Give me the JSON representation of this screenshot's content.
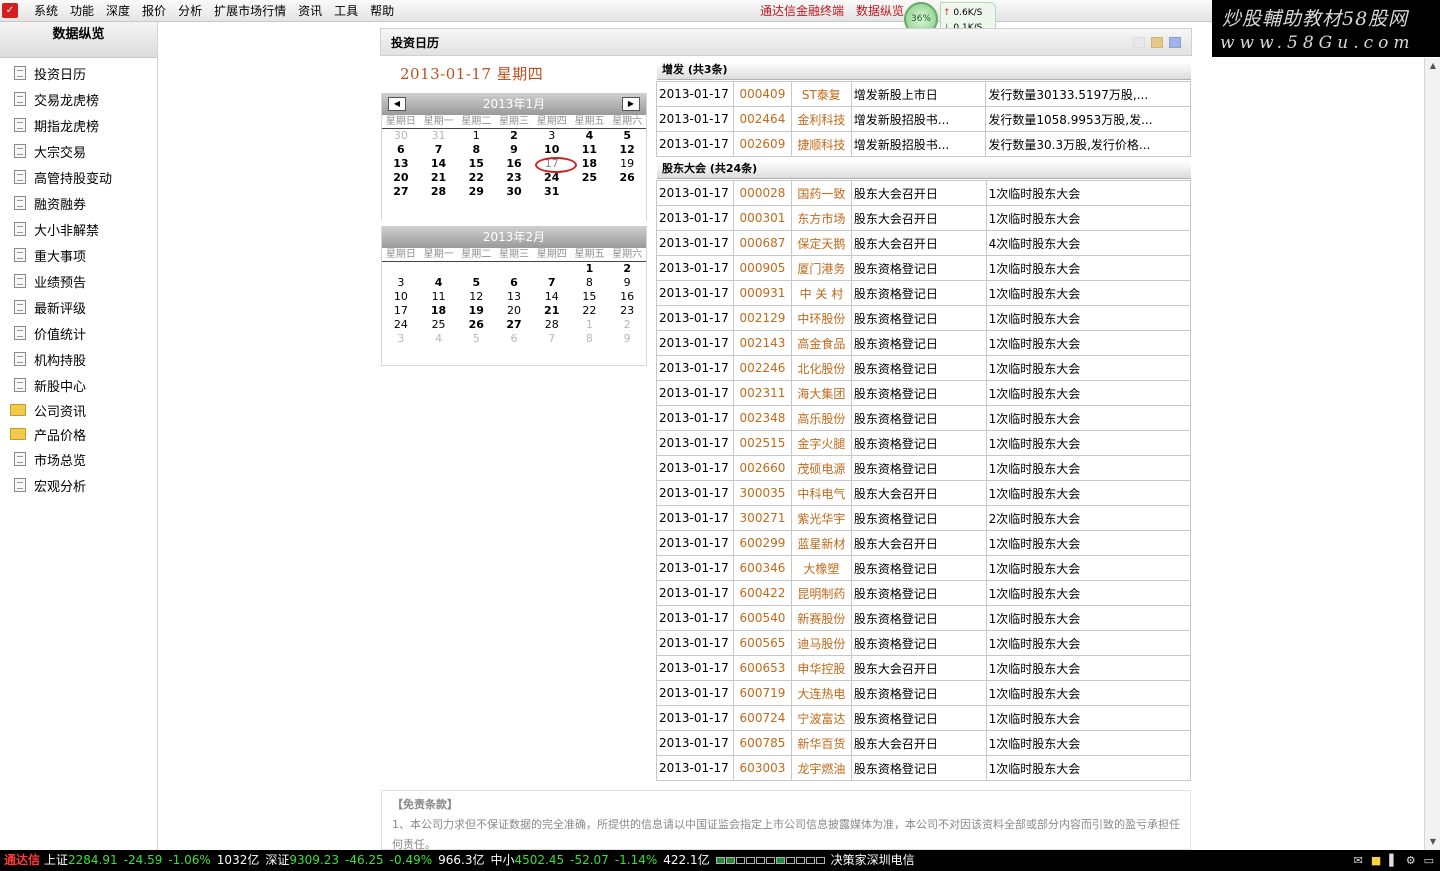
{
  "menubar": {
    "items": [
      "系统",
      "功能",
      "深度",
      "报价",
      "分析",
      "扩展市场行情",
      "资讯",
      "工具",
      "帮助"
    ],
    "links": [
      "通达信金融终端",
      "数据纵览"
    ],
    "net_percent": "36%",
    "up_speed": "0.6K/S",
    "down_speed": "0.1K/S"
  },
  "banner": {
    "line1": "炒股輔助教材58股网",
    "line2": "www.58Gu.com"
  },
  "sidebar": {
    "title": "数据纵览",
    "items": [
      "投资日历",
      "交易龙虎榜",
      "期指龙虎榜",
      "大宗交易",
      "高管持股变动",
      "融资融券",
      "大小非解禁",
      "重大事项",
      "业绩预告",
      "最新评级",
      "价值统计",
      "机构持股",
      "新股中心"
    ],
    "folders": [
      "公司资讯",
      "产品价格"
    ],
    "items2": [
      "市场总览",
      "宏观分析"
    ]
  },
  "panel": {
    "title": "投资日历",
    "skin_colors": [
      "#e8e8e8",
      "#e2c98a",
      "#9fb3e6"
    ]
  },
  "date_heading": "2013-01-17 星期四",
  "calendar": {
    "weekdays": [
      "星期日",
      "星期一",
      "星期二",
      "星期三",
      "星期四",
      "星期五",
      "星期六"
    ],
    "jan": {
      "title": "2013年1月",
      "days": [
        {
          "d": "30",
          "c": "other"
        },
        {
          "d": "31",
          "c": "other"
        },
        {
          "d": "1",
          "c": ""
        },
        {
          "d": "2",
          "c": "bold"
        },
        {
          "d": "3",
          "c": ""
        },
        {
          "d": "4",
          "c": "bold"
        },
        {
          "d": "5",
          "c": "bold"
        },
        {
          "d": "6",
          "c": "bold"
        },
        {
          "d": "7",
          "c": "bold"
        },
        {
          "d": "8",
          "c": "bold"
        },
        {
          "d": "9",
          "c": "bold"
        },
        {
          "d": "10",
          "c": "bold"
        },
        {
          "d": "11",
          "c": "bold"
        },
        {
          "d": "12",
          "c": "bold"
        },
        {
          "d": "13",
          "c": "bold"
        },
        {
          "d": "14",
          "c": "bold"
        },
        {
          "d": "15",
          "c": "bold"
        },
        {
          "d": "16",
          "c": "bold"
        },
        {
          "d": "17",
          "c": "today"
        },
        {
          "d": "18",
          "c": "bold"
        },
        {
          "d": "19",
          "c": ""
        },
        {
          "d": "20",
          "c": "bold"
        },
        {
          "d": "21",
          "c": "bold"
        },
        {
          "d": "22",
          "c": "bold"
        },
        {
          "d": "23",
          "c": "bold"
        },
        {
          "d": "24",
          "c": "bold"
        },
        {
          "d": "25",
          "c": "bold"
        },
        {
          "d": "26",
          "c": "bold"
        },
        {
          "d": "27",
          "c": "bold"
        },
        {
          "d": "28",
          "c": "bold"
        },
        {
          "d": "29",
          "c": "bold"
        },
        {
          "d": "30",
          "c": "bold"
        },
        {
          "d": "31",
          "c": "bold"
        },
        {
          "d": "",
          "c": ""
        },
        {
          "d": "",
          "c": ""
        }
      ]
    },
    "feb": {
      "title": "2013年2月",
      "days": [
        {
          "d": "",
          "c": ""
        },
        {
          "d": "",
          "c": ""
        },
        {
          "d": "",
          "c": ""
        },
        {
          "d": "",
          "c": ""
        },
        {
          "d": "",
          "c": ""
        },
        {
          "d": "1",
          "c": "bold"
        },
        {
          "d": "2",
          "c": "bold"
        },
        {
          "d": "3",
          "c": ""
        },
        {
          "d": "4",
          "c": "bold"
        },
        {
          "d": "5",
          "c": "bold"
        },
        {
          "d": "6",
          "c": "bold"
        },
        {
          "d": "7",
          "c": "bold"
        },
        {
          "d": "8",
          "c": ""
        },
        {
          "d": "9",
          "c": ""
        },
        {
          "d": "10",
          "c": ""
        },
        {
          "d": "11",
          "c": ""
        },
        {
          "d": "12",
          "c": ""
        },
        {
          "d": "13",
          "c": ""
        },
        {
          "d": "14",
          "c": ""
        },
        {
          "d": "15",
          "c": ""
        },
        {
          "d": "16",
          "c": ""
        },
        {
          "d": "17",
          "c": ""
        },
        {
          "d": "18",
          "c": "bold"
        },
        {
          "d": "19",
          "c": "bold"
        },
        {
          "d": "20",
          "c": ""
        },
        {
          "d": "21",
          "c": "bold"
        },
        {
          "d": "22",
          "c": ""
        },
        {
          "d": "23",
          "c": ""
        },
        {
          "d": "24",
          "c": ""
        },
        {
          "d": "25",
          "c": ""
        },
        {
          "d": "26",
          "c": "bold"
        },
        {
          "d": "27",
          "c": "bold"
        },
        {
          "d": "28",
          "c": ""
        },
        {
          "d": "1",
          "c": "other"
        },
        {
          "d": "2",
          "c": "other"
        },
        {
          "d": "3",
          "c": "other"
        },
        {
          "d": "4",
          "c": "other"
        },
        {
          "d": "5",
          "c": "other"
        },
        {
          "d": "6",
          "c": "other"
        },
        {
          "d": "7",
          "c": "other"
        },
        {
          "d": "8",
          "c": "other"
        },
        {
          "d": "9",
          "c": "other"
        }
      ]
    }
  },
  "placement": {
    "title": "增发 (共3条)",
    "rows": [
      [
        "2013-01-17",
        "000409",
        "ST泰复",
        "增发新股上市日",
        "发行数量30133.5197万股,..."
      ],
      [
        "2013-01-17",
        "002464",
        "金利科技",
        "增发新股招股书...",
        "发行数量1058.9953万股,发..."
      ],
      [
        "2013-01-17",
        "002609",
        "捷顺科技",
        "增发新股招股书...",
        "发行数量30.3万股,发行价格..."
      ]
    ]
  },
  "meetings": {
    "title": "股东大会 (共24条)",
    "rows": [
      [
        "2013-01-17",
        "000028",
        "国药一致",
        "股东大会召开日",
        "1次临时股东大会"
      ],
      [
        "2013-01-17",
        "000301",
        "东方市场",
        "股东大会召开日",
        "1次临时股东大会"
      ],
      [
        "2013-01-17",
        "000687",
        "保定天鹅",
        "股东大会召开日",
        "4次临时股东大会"
      ],
      [
        "2013-01-17",
        "000905",
        "厦门港务",
        "股东资格登记日",
        "1次临时股东大会"
      ],
      [
        "2013-01-17",
        "000931",
        "中 关 村",
        "股东资格登记日",
        "1次临时股东大会"
      ],
      [
        "2013-01-17",
        "002129",
        "中环股份",
        "股东资格登记日",
        "1次临时股东大会"
      ],
      [
        "2013-01-17",
        "002143",
        "高金食品",
        "股东资格登记日",
        "1次临时股东大会"
      ],
      [
        "2013-01-17",
        "002246",
        "北化股份",
        "股东资格登记日",
        "1次临时股东大会"
      ],
      [
        "2013-01-17",
        "002311",
        "海大集团",
        "股东资格登记日",
        "1次临时股东大会"
      ],
      [
        "2013-01-17",
        "002348",
        "高乐股份",
        "股东资格登记日",
        "1次临时股东大会"
      ],
      [
        "2013-01-17",
        "002515",
        "金字火腿",
        "股东资格登记日",
        "1次临时股东大会"
      ],
      [
        "2013-01-17",
        "002660",
        "茂硕电源",
        "股东资格登记日",
        "1次临时股东大会"
      ],
      [
        "2013-01-17",
        "300035",
        "中科电气",
        "股东大会召开日",
        "1次临时股东大会"
      ],
      [
        "2013-01-17",
        "300271",
        "紫光华宇",
        "股东资格登记日",
        "2次临时股东大会"
      ],
      [
        "2013-01-17",
        "600299",
        "蓝星新材",
        "股东大会召开日",
        "1次临时股东大会"
      ],
      [
        "2013-01-17",
        "600346",
        "大橡塑",
        "股东资格登记日",
        "1次临时股东大会"
      ],
      [
        "2013-01-17",
        "600422",
        "昆明制药",
        "股东资格登记日",
        "1次临时股东大会"
      ],
      [
        "2013-01-17",
        "600540",
        "新赛股份",
        "股东资格登记日",
        "1次临时股东大会"
      ],
      [
        "2013-01-17",
        "600565",
        "迪马股份",
        "股东资格登记日",
        "1次临时股东大会"
      ],
      [
        "2013-01-17",
        "600653",
        "申华控股",
        "股东大会召开日",
        "1次临时股东大会"
      ],
      [
        "2013-01-17",
        "600719",
        "大连热电",
        "股东资格登记日",
        "1次临时股东大会"
      ],
      [
        "2013-01-17",
        "600724",
        "宁波富达",
        "股东资格登记日",
        "1次临时股东大会"
      ],
      [
        "2013-01-17",
        "600785",
        "新华百货",
        "股东大会召开日",
        "1次临时股东大会"
      ],
      [
        "2013-01-17",
        "603003",
        "龙宇燃油",
        "股东资格登记日",
        "1次临时股东大会"
      ]
    ]
  },
  "disclaimer": {
    "title": "【免责条款】",
    "text": "1、本公司力求但不保证数据的完全准确，所提供的信息请以中国证监会指定上市公司信息披露媒体为准，本公司不对因该资料全部或部分内容而引致的盈亏承担任何责任。"
  },
  "statusbar": {
    "brand": "通达信",
    "sh_label": "上证",
    "sh_value": "2284.91",
    "sh_change": "-24.59",
    "sh_pct": "-1.06%",
    "sh_amount": "1032亿",
    "sz_label": "深证",
    "sz_value": "9309.23",
    "sz_change": "-46.25",
    "sz_pct": "-0.49%",
    "sz_amount": "966.3亿",
    "zx_label": "中小",
    "zx_value": "4502.45",
    "zx_change": "-52.07",
    "zx_pct": "-1.14%",
    "zx_amount": "422.1亿",
    "server": "决策家深圳电信"
  }
}
